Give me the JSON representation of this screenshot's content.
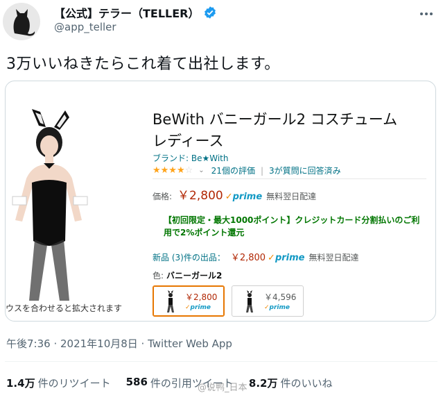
{
  "tweet": {
    "display_name": "【公式】テラー（TELLER）",
    "handle": "@app_teller",
    "more_icon": "more-dots-icon",
    "text": "3万いいねきたらこれ着て出社します。",
    "timestamp": "午後7:36 · 2021年10月8日 · Twitter Web App"
  },
  "product": {
    "title_line1": "BeWith バニーガール2 コスチューム",
    "title_line2": "レディース",
    "brand": "ブランド: Be★With",
    "rating": 4,
    "reviews": "21個の評価",
    "divider": "|",
    "qa": "3が質問に回答済み",
    "price_label": "価格:",
    "price": "￥2,800",
    "prime": "prime",
    "shipping": "無料翌日配達",
    "promo": "【初回限定・最大1000ポイント】クレジットカード分割払いのご利用で2%ポイント還元",
    "new_label": "新品 (3)件の出品：",
    "new_price": "￥2,800",
    "color_label": "色:",
    "color_value": "バニーガール2",
    "zoom_hint": "ウスを合わせると拡大されます",
    "swatches": [
      {
        "price": "￥2,800",
        "prime": "prime"
      },
      {
        "price": "￥4,596",
        "prime": "prime"
      }
    ]
  },
  "stats": {
    "retweets_count": "1.4万",
    "retweets_label": "件のリツイート",
    "quotes_count": "586",
    "quotes_label": "件の引用ツイート",
    "likes_count": "8.2万",
    "likes_label": "件のいいね"
  },
  "watermark": "@说鸭_日本",
  "colors": {
    "verified": "#1d9bf0",
    "price": "#b12704",
    "link": "#007185",
    "prime": "#1399c4",
    "promo": "#007600"
  }
}
